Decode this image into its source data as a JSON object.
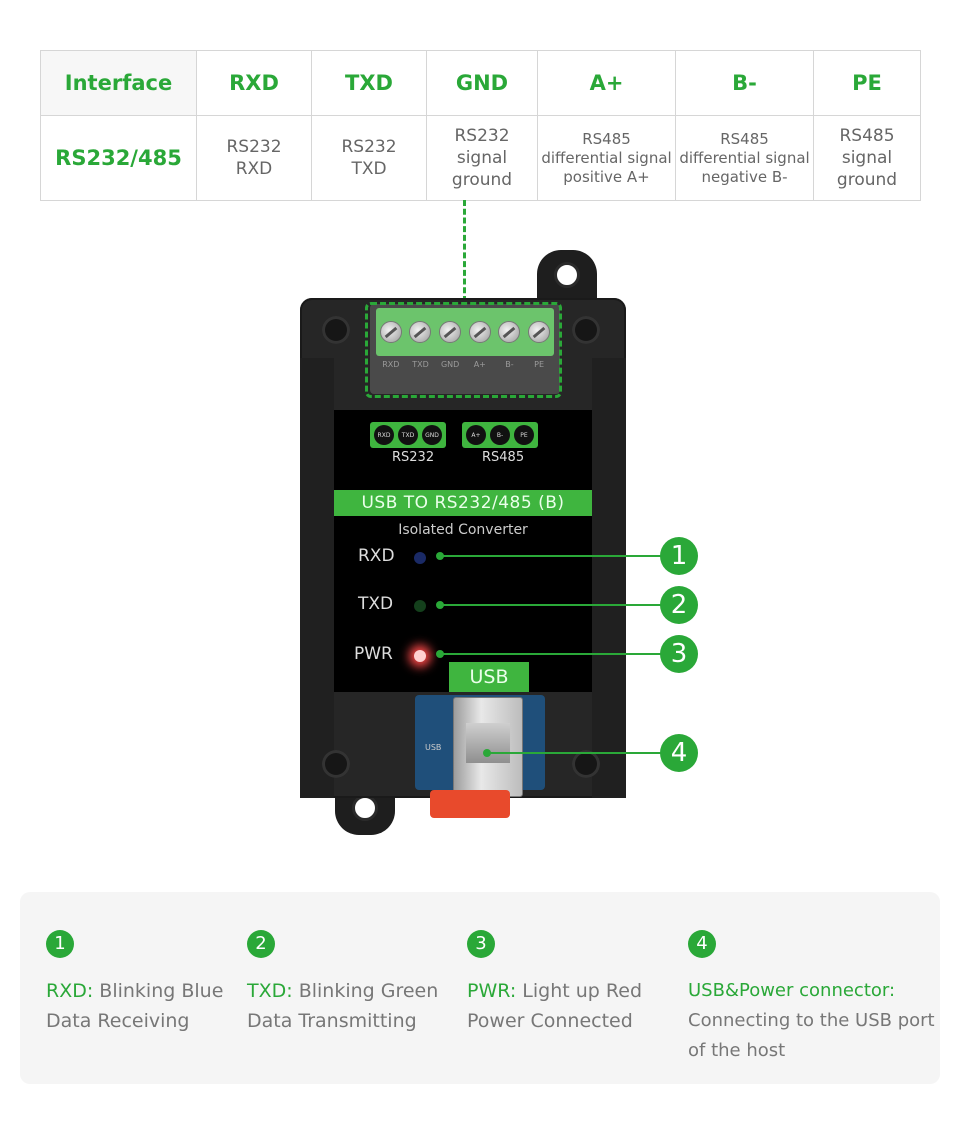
{
  "colors": {
    "accent_green": "#2aa838",
    "panel_green": "#3fb53f",
    "device_black": "#262626",
    "pwr_led": "#ff4a4a",
    "rxd_led": "#1a2a66",
    "txd_led": "#14401c",
    "legend_bg": "#f5f5f5"
  },
  "table": {
    "header": [
      "Interface",
      "RXD",
      "TXD",
      "GND",
      "A+",
      "B-",
      "PE"
    ],
    "row": [
      "RS232/485",
      "RS232\nRXD",
      "RS232\nTXD",
      "RS232\nsignal\nground",
      "RS485\ndifferential signal\npositive A+",
      "RS485\ndifferential signal\nnegative B-",
      "RS485\nsignal\nground"
    ]
  },
  "device": {
    "terminal_pins": [
      "RXD",
      "TXD",
      "GND",
      "A+",
      "B-",
      "PE"
    ],
    "rs232_pins": [
      "RXD",
      "TXD",
      "GND"
    ],
    "rs485_pins": [
      "A+",
      "B-",
      "PE"
    ],
    "rs232_label": "RS232",
    "rs485_label": "RS485",
    "title": "USB TO RS232/485 (B)",
    "subtitle": "Isolated Converter",
    "leds": [
      {
        "label": "RXD",
        "state": "off",
        "color": "blue"
      },
      {
        "label": "TXD",
        "state": "off",
        "color": "green"
      },
      {
        "label": "PWR",
        "state": "on",
        "color": "red"
      }
    ],
    "usb_tag": "USB",
    "usb_small_label": "USB"
  },
  "callouts": [
    "1",
    "2",
    "3",
    "4"
  ],
  "legend": [
    {
      "num": "1",
      "key": "RXD:",
      "desc": " Blinking Blue",
      "line2": "Data Receiving"
    },
    {
      "num": "2",
      "key": "TXD:",
      "desc": " Blinking Green",
      "line2": "Data Transmitting"
    },
    {
      "num": "3",
      "key": "PWR:",
      "desc": " Light up Red",
      "line2": "Power Connected"
    },
    {
      "num": "4",
      "key": "USB&Power connector:",
      "desc": "",
      "line2": "Connecting to the USB port",
      "line3": "of the host"
    }
  ]
}
